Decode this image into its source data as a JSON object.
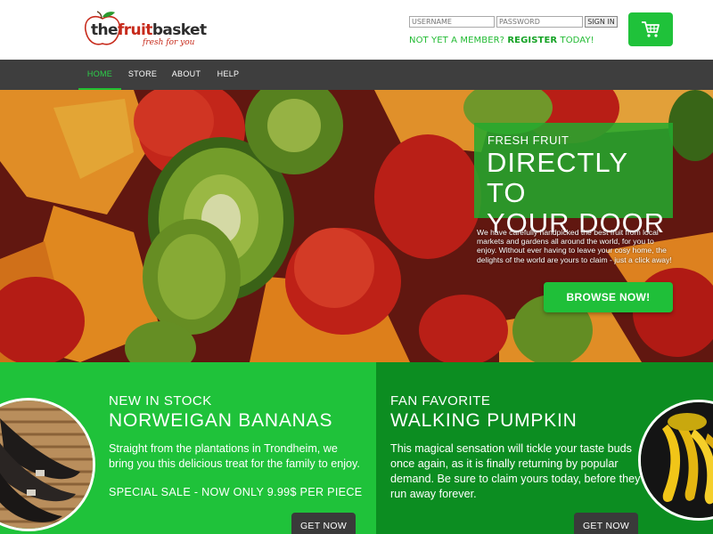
{
  "brand": {
    "name_the": "the",
    "name_fruit": "fruit",
    "name_basket": "basket",
    "tagline": "fresh for you"
  },
  "login": {
    "username_placeholder": "USERNAME",
    "password_placeholder": "PASSWORD",
    "signin_label": "SIGN IN",
    "member_prefix": "NOT YET A MEMBER?",
    "register_label": "REGISTER",
    "member_suffix": "TODAY!"
  },
  "cart": {
    "icon": "shopping-cart-icon"
  },
  "nav": {
    "items": [
      {
        "label": "HOME",
        "active": true
      },
      {
        "label": "STORE",
        "active": false
      },
      {
        "label": "ABOUT",
        "active": false
      },
      {
        "label": "HELP",
        "active": false
      }
    ]
  },
  "hero": {
    "kicker": "FRESH FRUIT",
    "headline_line1": "DIRECTLY TO",
    "headline_line2": "YOUR DOOR",
    "description": "We have carefully handpicked the best fruit from local markets and gardens all around the world, for you to enjoy. Without ever having to leave your cosy home, the delights of the world are yours to claim - just a click away!",
    "cta_label": "BROWSE NOW!"
  },
  "features": [
    {
      "kicker": "NEW IN STOCK",
      "title": "NORWEIGAN BANANAS",
      "description": "Straight from the plantations in Trondheim, we bring you this delicious treat for the family to enjoy.",
      "sale": "SPECIAL SALE - NOW ONLY 9.99$ PER PIECE",
      "cta_label": "GET NOW"
    },
    {
      "kicker": "FAN FAVORITE",
      "title": "WALKING PUMPKIN",
      "description": "This magical sensation will tickle your taste buds once again, as it is finally returning by popular demand. Be sure to claim yours today, before they run away forever.",
      "cta_label": "GET NOW"
    }
  ],
  "colors": {
    "accent_green": "#1fc23a",
    "dark_green": "#0c8d21",
    "nav_bg": "#3e3e3e",
    "brand_red": "#c72a1b"
  }
}
